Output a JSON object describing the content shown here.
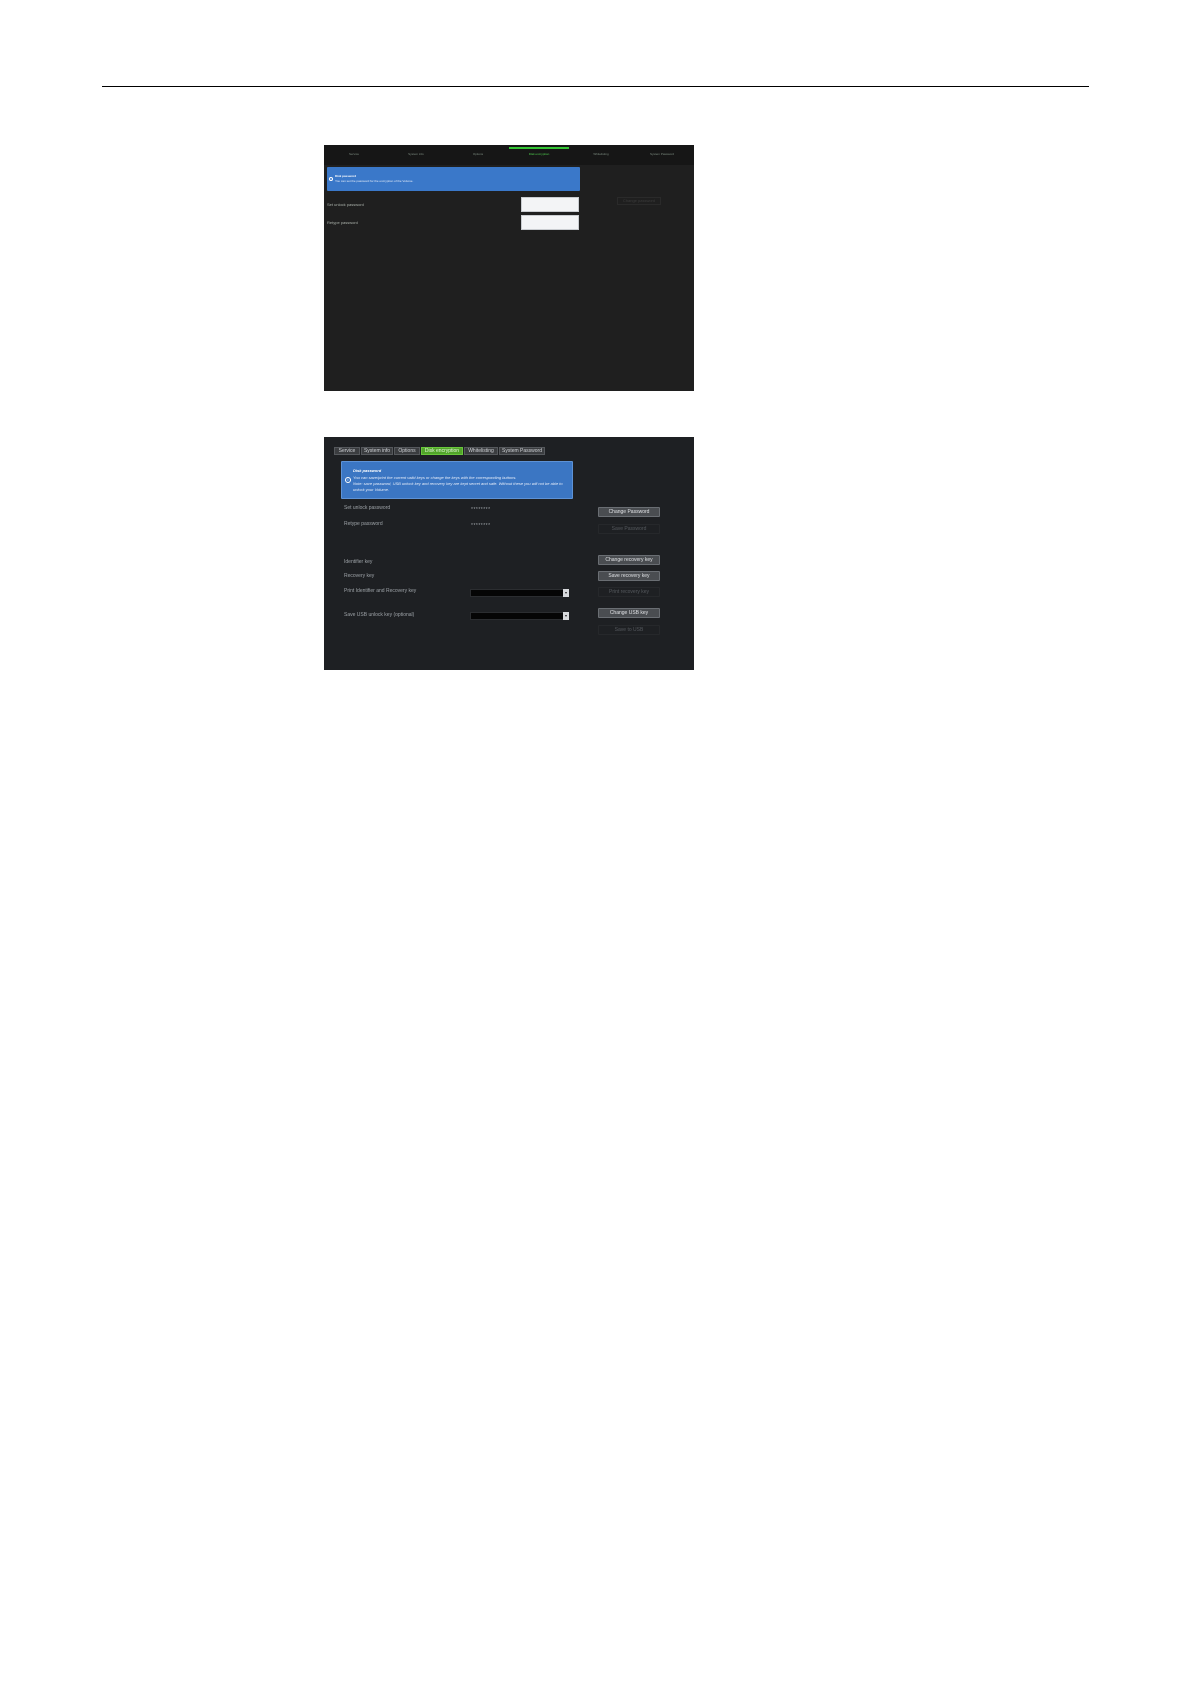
{
  "shot1": {
    "tabs": [
      {
        "label": "Service",
        "active": false
      },
      {
        "label": "System info",
        "active": false
      },
      {
        "label": "Options",
        "active": false
      },
      {
        "label": "Disk encryption",
        "active": true
      },
      {
        "label": "Whitelisting",
        "active": false
      },
      {
        "label": "System Password",
        "active": false
      }
    ],
    "banner": {
      "title": "Disk password",
      "text": "You can set the password for the encryption of the Volume."
    },
    "set_unlock_label": "Set unlock password",
    "retype_label": "Retype password",
    "button_label": "Change password"
  },
  "shot2": {
    "tabs": [
      {
        "label": "Service",
        "active": false
      },
      {
        "label": "System info",
        "active": false
      },
      {
        "label": "Options",
        "active": false
      },
      {
        "label": "Disk encryption",
        "active": true
      },
      {
        "label": "Whitelisting",
        "active": false
      },
      {
        "label": "System Password",
        "active": false
      }
    ],
    "banner": {
      "title": "Disk password",
      "line1": "You can save/print the current valid keys or change the keys with the corresponding buttons.",
      "line2": "Note: save password, USB unlock key and recovery key are kept secret and safe. Without these you will not be able to",
      "line3": "unlock your Volume."
    },
    "set_unlock_label": "Set unlock password",
    "set_unlock_value": "********",
    "retype_label": "Retype password",
    "retype_value": "********",
    "identifier_label": "Identifier key",
    "recovery_label": "Recovery key",
    "print_label": "Print Identifier and Recovery key",
    "usb_label": "Save USB unlock key (optional)",
    "buttons": {
      "change_password": "Change Password",
      "save_password": "Save Password",
      "change_recovery": "Change recovery key",
      "save_recovery": "Save recovery key",
      "print_recovery": "Print recovery key",
      "change_usb": "Change USB key",
      "save_usb": "Save to USB"
    }
  }
}
